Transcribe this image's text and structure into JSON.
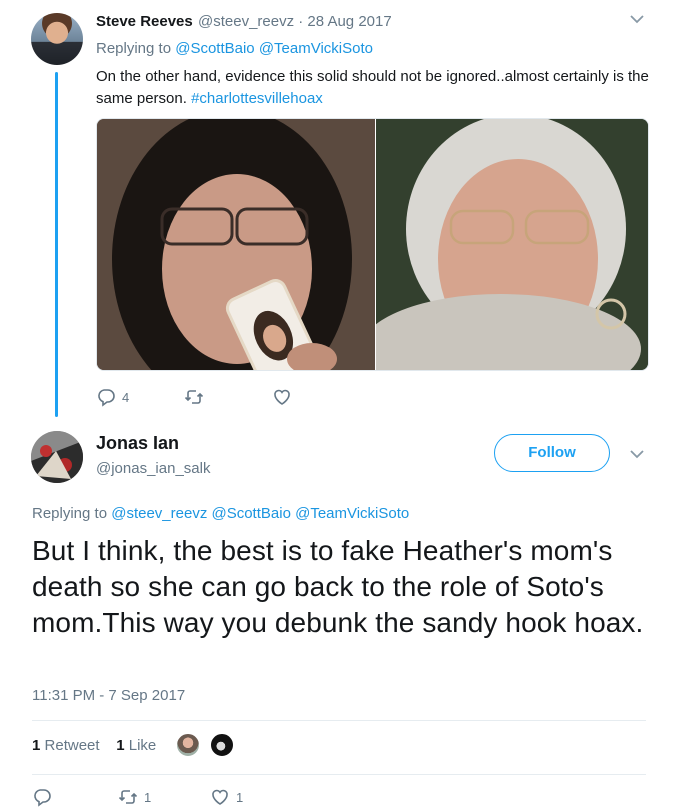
{
  "parent_tweet": {
    "name": "Steve Reeves",
    "handle_time": "@steev_reevz · 28 Aug 2017",
    "replying_prefix": "Replying to ",
    "replying_handles": "@ScottBaio @TeamVickiSoto",
    "text": "On the other hand, evidence this solid should not be ignored..almost certainly is the same person.",
    "hashtag": "#charlottesvillehoax",
    "reply_count": "4",
    "retweet_count": "",
    "like_count": ""
  },
  "focus_tweet": {
    "name": "Jonas Ian",
    "handle": "@jonas_ian_salk",
    "follow_label": "Follow",
    "replying_prefix": "Replying to ",
    "replying_handles": "@steev_reevz @ScottBaio @TeamVickiSoto",
    "text": "But I think, the best is to fake Heather's mom's death so she can go back to the role of Soto's mom.This way you debunk the sandy hook hoax.",
    "timestamp": "11:31 PM - 7 Sep 2017",
    "retweets_num": "1",
    "retweets_label": "Retweet",
    "likes_num": "1",
    "likes_label": "Like",
    "reply_count": "",
    "retweet_count": "1",
    "like_count": "1"
  },
  "colors": {
    "link_blue": "#1b95e0",
    "thread_line": "#1da1f2",
    "muted": "#657786",
    "divider": "#e6ecf0"
  },
  "icons": [
    "chevron-down-icon",
    "reply-icon",
    "retweet-icon",
    "heart-icon"
  ]
}
